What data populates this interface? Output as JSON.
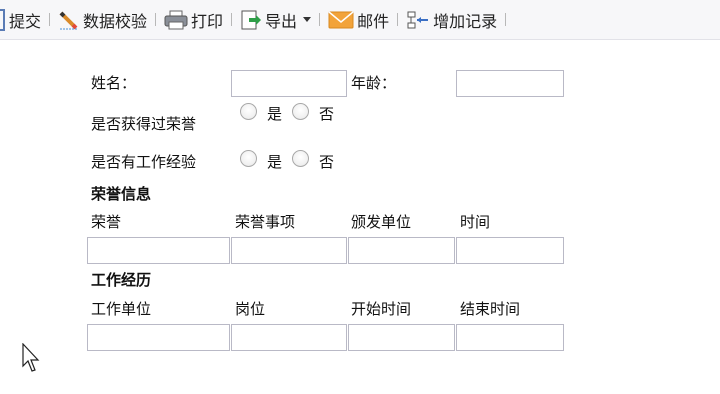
{
  "toolbar": {
    "submit": "提交",
    "validate": "数据校验",
    "print": "打印",
    "export": "导出",
    "email": "邮件",
    "add_record": "增加记录"
  },
  "form": {
    "name_label": "姓名：",
    "name_value": "",
    "age_label": "年龄：",
    "age_value": "",
    "honor_q": "是否获得过荣誉",
    "work_q": "是否有工作经验",
    "yes": "是",
    "no": "否",
    "honor_section": "荣誉信息",
    "honor_cols": [
      "荣誉",
      "荣誉事项",
      "颁发单位",
      "时间"
    ],
    "work_section": "工作经历",
    "work_cols": [
      "工作单位",
      "岗位",
      "开始时间",
      "结束时间"
    ]
  },
  "colors": {
    "toolbar_bg": "#f7f7f9",
    "input_border": "#b9b9c6",
    "export_icon_green": "#2e9e48",
    "mail_icon_orange": "#f2a33a"
  }
}
